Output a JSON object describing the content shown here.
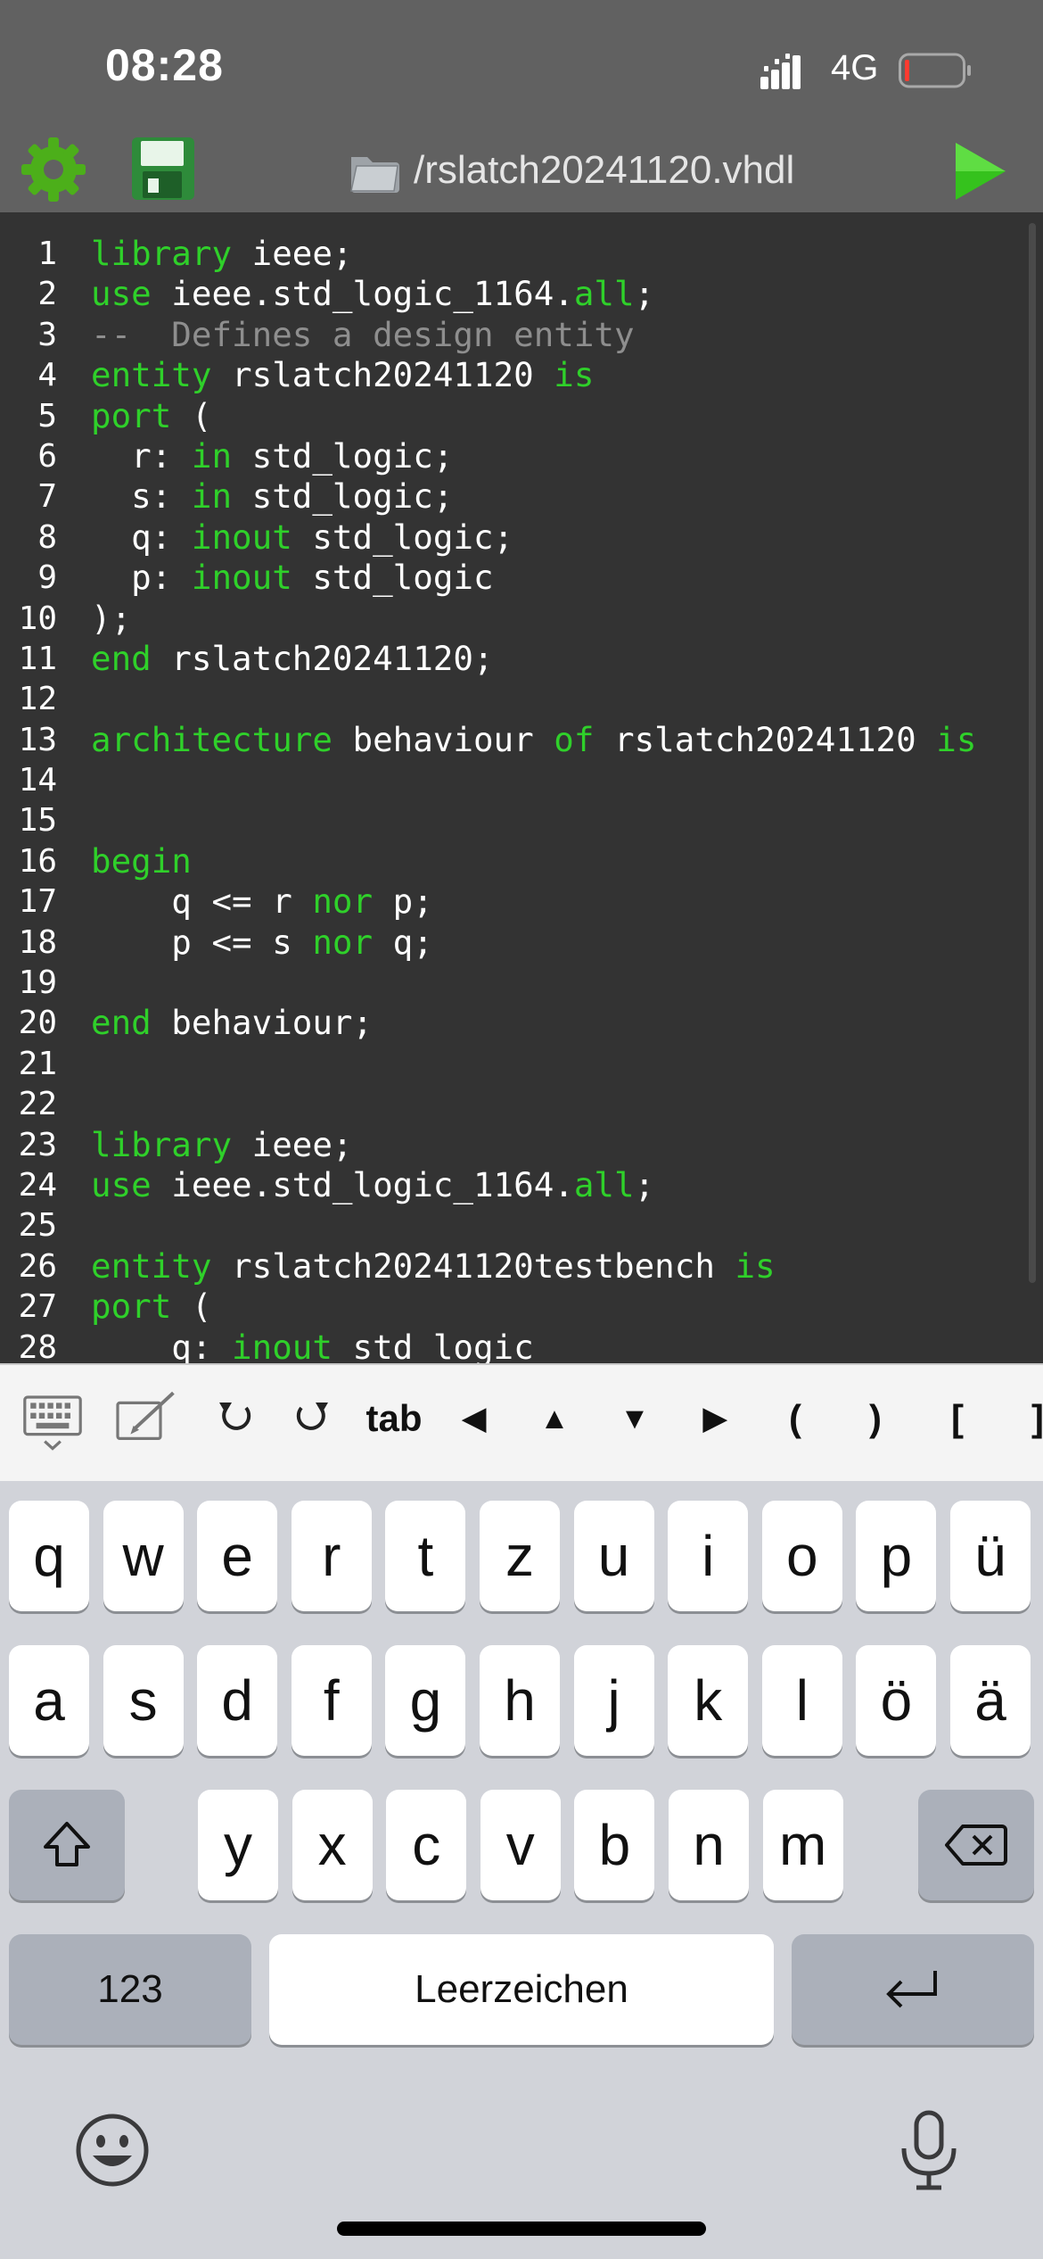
{
  "status_bar": {
    "time": "08:28",
    "network": "4G",
    "signal_icon": "signal-bars-icon",
    "battery_icon": "battery-low-icon"
  },
  "toolbar": {
    "settings_icon": "gear-icon",
    "save_icon": "floppy-disk-icon",
    "folder_icon": "folder-icon",
    "file_path": "/rslatch20241120.vhdl",
    "run_icon": "play-icon"
  },
  "colors": {
    "keyword": "#2fd02a",
    "comment": "#8e8e8e",
    "editor_background": "#333333",
    "toolbar_background": "#616161"
  },
  "editor": {
    "lines": [
      {
        "num": "1",
        "parts": [
          {
            "t": "library",
            "c": "kw"
          },
          {
            "t": " ieee;"
          }
        ]
      },
      {
        "num": "2",
        "parts": [
          {
            "t": "use",
            "c": "kw"
          },
          {
            "t": " ieee.std_logic_1164."
          },
          {
            "t": "all",
            "c": "kw"
          },
          {
            "t": ";"
          }
        ]
      },
      {
        "num": "3",
        "parts": [
          {
            "t": "--  Defines a design entity",
            "c": "cm"
          }
        ]
      },
      {
        "num": "4",
        "parts": [
          {
            "t": "entity",
            "c": "kw"
          },
          {
            "t": " rslatch20241120 "
          },
          {
            "t": "is",
            "c": "kw"
          }
        ]
      },
      {
        "num": "5",
        "parts": [
          {
            "t": "port",
            "c": "kw"
          },
          {
            "t": " ("
          }
        ]
      },
      {
        "num": "6",
        "parts": [
          {
            "t": "  r: "
          },
          {
            "t": "in",
            "c": "kw"
          },
          {
            "t": " std_logic;"
          }
        ]
      },
      {
        "num": "7",
        "parts": [
          {
            "t": "  s: "
          },
          {
            "t": "in",
            "c": "kw"
          },
          {
            "t": " std_logic;"
          }
        ]
      },
      {
        "num": "8",
        "parts": [
          {
            "t": "  q: "
          },
          {
            "t": "inout",
            "c": "kw"
          },
          {
            "t": " std_logic;"
          }
        ]
      },
      {
        "num": "9",
        "parts": [
          {
            "t": "  p: "
          },
          {
            "t": "inout",
            "c": "kw"
          },
          {
            "t": " std_logic"
          }
        ]
      },
      {
        "num": "10",
        "parts": [
          {
            "t": ");"
          }
        ]
      },
      {
        "num": "11",
        "parts": [
          {
            "t": "end",
            "c": "kw"
          },
          {
            "t": " rslatch20241120;"
          }
        ]
      },
      {
        "num": "12",
        "parts": []
      },
      {
        "num": "13",
        "parts": [
          {
            "t": "architecture",
            "c": "kw"
          },
          {
            "t": " behaviour "
          },
          {
            "t": "of",
            "c": "kw"
          },
          {
            "t": " rslatch20241120 "
          },
          {
            "t": "is",
            "c": "kw"
          }
        ]
      },
      {
        "num": "14",
        "parts": []
      },
      {
        "num": "15",
        "parts": []
      },
      {
        "num": "16",
        "parts": [
          {
            "t": "begin",
            "c": "kw"
          }
        ]
      },
      {
        "num": "17",
        "parts": [
          {
            "t": "    q <= r "
          },
          {
            "t": "nor",
            "c": "kw"
          },
          {
            "t": " p;"
          }
        ]
      },
      {
        "num": "18",
        "parts": [
          {
            "t": "    p <= s "
          },
          {
            "t": "nor",
            "c": "kw"
          },
          {
            "t": " q;"
          }
        ]
      },
      {
        "num": "19",
        "parts": []
      },
      {
        "num": "20",
        "parts": [
          {
            "t": "end",
            "c": "kw"
          },
          {
            "t": " behaviour;"
          }
        ]
      },
      {
        "num": "21",
        "parts": []
      },
      {
        "num": "22",
        "parts": []
      },
      {
        "num": "23",
        "parts": [
          {
            "t": "library",
            "c": "kw"
          },
          {
            "t": " ieee;"
          }
        ]
      },
      {
        "num": "24",
        "parts": [
          {
            "t": "use",
            "c": "kw"
          },
          {
            "t": " ieee.std_logic_1164."
          },
          {
            "t": "all",
            "c": "kw"
          },
          {
            "t": ";"
          }
        ]
      },
      {
        "num": "25",
        "parts": []
      },
      {
        "num": "26",
        "parts": [
          {
            "t": "entity",
            "c": "kw"
          },
          {
            "t": " rslatch20241120testbench "
          },
          {
            "t": "is",
            "c": "kw"
          }
        ]
      },
      {
        "num": "27",
        "parts": [
          {
            "t": "port",
            "c": "kw"
          },
          {
            "t": " ("
          }
        ]
      },
      {
        "num": "28",
        "parts": [
          {
            "t": "    q: "
          },
          {
            "t": "inout",
            "c": "kw"
          },
          {
            "t": " std_logic"
          }
        ]
      }
    ]
  },
  "accessory_bar": {
    "keyboard_toggle_icon": "keyboard-dismiss-icon",
    "edit_icon": "pencil-pad-icon",
    "undo_icon": "undo-icon",
    "redo_icon": "redo-icon",
    "tab_label": "tab",
    "arrow_left": "◀",
    "arrow_up": "▲",
    "arrow_down": "▼",
    "arrow_right": "▶",
    "paren_open": "(",
    "paren_close": ")",
    "bracket_open": "[",
    "bracket_close": "]"
  },
  "keyboard": {
    "row1": [
      "q",
      "w",
      "e",
      "r",
      "t",
      "z",
      "u",
      "i",
      "o",
      "p",
      "ü"
    ],
    "row2": [
      "a",
      "s",
      "d",
      "f",
      "g",
      "h",
      "j",
      "k",
      "l",
      "ö",
      "ä"
    ],
    "row3": [
      "y",
      "x",
      "c",
      "v",
      "b",
      "n",
      "m"
    ],
    "shift_icon": "shift-icon",
    "backspace_icon": "backspace-icon",
    "numbers_label": "123",
    "space_label": "Leerzeichen",
    "return_icon": "return-icon",
    "emoji_icon": "emoji-icon",
    "mic_icon": "microphone-icon"
  }
}
